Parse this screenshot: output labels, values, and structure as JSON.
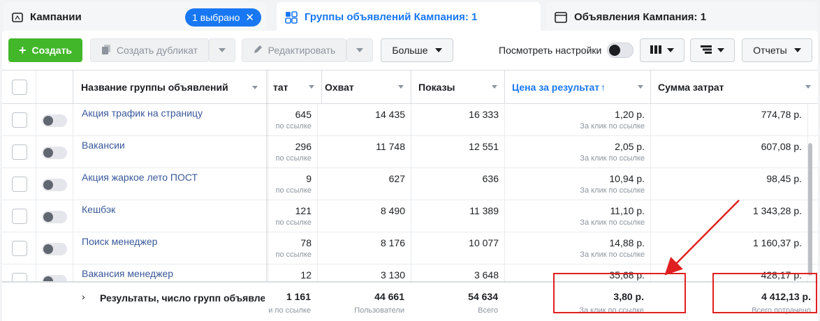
{
  "tabs": {
    "campaigns": "Кампании",
    "selected_badge": "1 выбрано",
    "adsets": "Группы объявлений Кампания: 1",
    "ads": "Объявления Кампания: 1"
  },
  "toolbar": {
    "create": "Создать",
    "duplicate": "Создать дубликат",
    "edit": "Редактировать",
    "more": "Больше",
    "view_settings": "Посмотреть настройки",
    "reports": "Отчеты"
  },
  "columns": {
    "name": "Название группы объявлений",
    "results": "тат",
    "reach": "Охват",
    "impressions": "Показы",
    "cost_per_result": "Цена за результат",
    "amount_spent": "Сумма затрат"
  },
  "rows": [
    {
      "name": "Акция трафик на страницу",
      "results": "645",
      "results_sub": "по ссылке",
      "reach": "14 435",
      "impressions": "16 333",
      "cpr": "1,20 р.",
      "cpr_sub": "За клик по ссылке",
      "spent": "774,78 р."
    },
    {
      "name": "Вакансии",
      "results": "296",
      "results_sub": "по ссылке",
      "reach": "11 748",
      "impressions": "12 551",
      "cpr": "2,05 р.",
      "cpr_sub": "За клик по ссылке",
      "spent": "607,08 р."
    },
    {
      "name": "Акция жаркое лето ПОСТ",
      "results": "9",
      "results_sub": "по ссылке",
      "reach": "627",
      "impressions": "636",
      "cpr": "10,94 р.",
      "cpr_sub": "За клик по ссылке",
      "spent": "98,45 р."
    },
    {
      "name": "Кешбэк",
      "results": "121",
      "results_sub": "по ссылке",
      "reach": "8 490",
      "impressions": "11 389",
      "cpr": "11,10 р.",
      "cpr_sub": "За клик по ссылке",
      "spent": "1 343,28 р."
    },
    {
      "name": "Поиск менеджер",
      "results": "78",
      "results_sub": "по ссылке",
      "reach": "8 176",
      "impressions": "10 077",
      "cpr": "14,88 р.",
      "cpr_sub": "За клик по ссылке",
      "spent": "1 160,37 р."
    },
    {
      "name": "Вакансия менеджер",
      "results": "12",
      "results_sub": "",
      "reach": "3 130",
      "impressions": "3 648",
      "cpr": "35,68 р.",
      "cpr_sub": "",
      "spent": "428,17 р."
    }
  ],
  "footer": {
    "label": "Результаты, число групп объявле",
    "results": "1 161",
    "results_sub": "и по ссылке",
    "reach": "44 661",
    "reach_sub": "Пользователи",
    "impressions": "54 634",
    "impressions_sub": "Всего",
    "cpr": "3,80 р.",
    "cpr_sub": "За клик по ссылке",
    "spent": "4 412,13 р.",
    "spent_sub": "Всего потрачено"
  },
  "colors": {
    "accent": "#1877f2",
    "create": "#42b72a",
    "highlight": "#e02020"
  }
}
